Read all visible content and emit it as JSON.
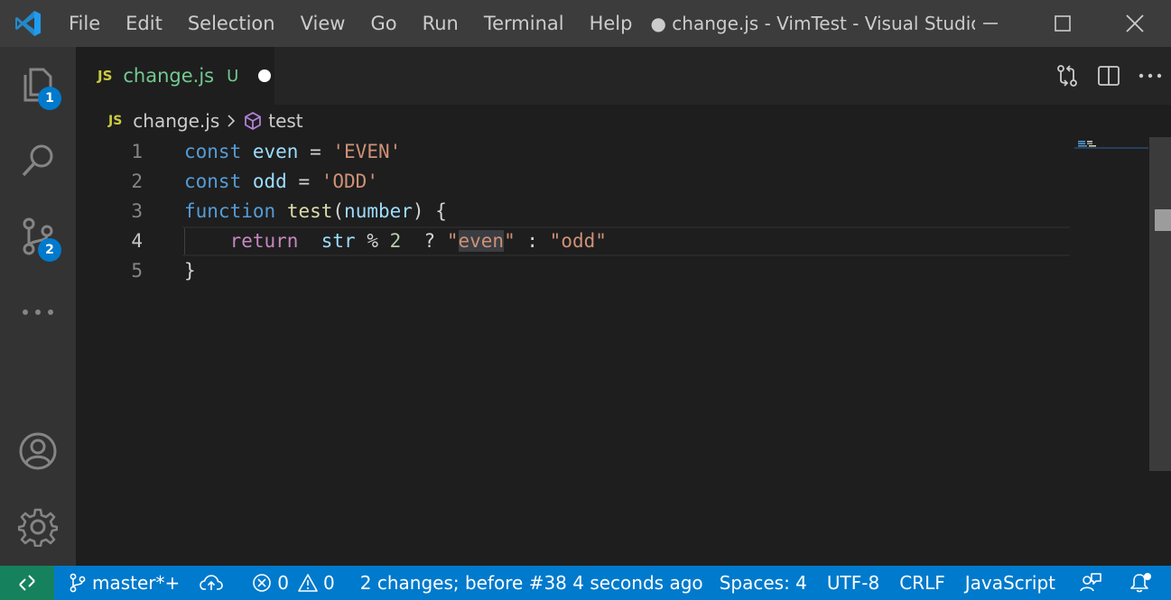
{
  "window": {
    "title": "● change.js - VimTest - Visual Studio..."
  },
  "menu": [
    "File",
    "Edit",
    "Selection",
    "View",
    "Go",
    "Run",
    "Terminal",
    "Help"
  ],
  "activity": {
    "explorer_badge": "1",
    "scm_badge": "2"
  },
  "tab": {
    "icon_label": "JS",
    "name": "change.js",
    "status": "U"
  },
  "breadcrumb": {
    "icon_label": "JS",
    "file": "change.js",
    "symbol": "test"
  },
  "editor": {
    "lines": [
      {
        "number": "1",
        "tokens": [
          {
            "t": "const",
            "c": "kw"
          },
          {
            "t": " ",
            "c": ""
          },
          {
            "t": "even",
            "c": "var"
          },
          {
            "t": " = ",
            "c": ""
          },
          {
            "t": "'EVEN'",
            "c": "str"
          }
        ]
      },
      {
        "number": "2",
        "tokens": [
          {
            "t": "const",
            "c": "kw"
          },
          {
            "t": " ",
            "c": ""
          },
          {
            "t": "odd",
            "c": "var"
          },
          {
            "t": " = ",
            "c": ""
          },
          {
            "t": "'ODD'",
            "c": "str"
          }
        ]
      },
      {
        "number": "3",
        "tokens": [
          {
            "t": "function",
            "c": "kw"
          },
          {
            "t": " ",
            "c": ""
          },
          {
            "t": "test",
            "c": "fn"
          },
          {
            "t": "(",
            "c": ""
          },
          {
            "t": "number",
            "c": "var"
          },
          {
            "t": ") {",
            "c": ""
          }
        ]
      },
      {
        "number": "4",
        "tokens": [
          {
            "t": "    ",
            "c": ""
          },
          {
            "t": "return",
            "c": "ctl"
          },
          {
            "t": "  ",
            "c": ""
          },
          {
            "t": "str",
            "c": "var"
          },
          {
            "t": " % ",
            "c": ""
          },
          {
            "t": "2",
            "c": "num"
          },
          {
            "t": "  ? ",
            "c": ""
          },
          {
            "t": "\"",
            "c": "str"
          },
          {
            "t": "even",
            "c": "str hl"
          },
          {
            "t": "\"",
            "c": "str"
          },
          {
            "t": " : ",
            "c": ""
          },
          {
            "t": "\"odd\"",
            "c": "str"
          }
        ]
      },
      {
        "number": "5",
        "tokens": [
          {
            "t": "}",
            "c": ""
          }
        ]
      }
    ],
    "active_line": "4"
  },
  "statusbar": {
    "branch": "master*+",
    "errors": "0",
    "warnings": "0",
    "message": "2 changes; before #38  4 seconds ago",
    "spaces": "Spaces: 4",
    "encoding": "UTF-8",
    "eol": "CRLF",
    "language": "JavaScript"
  },
  "colors": {
    "accent": "#007acc",
    "remote": "#16825d",
    "modified_file": "#73c991",
    "js_icon": "#cbcb41"
  }
}
